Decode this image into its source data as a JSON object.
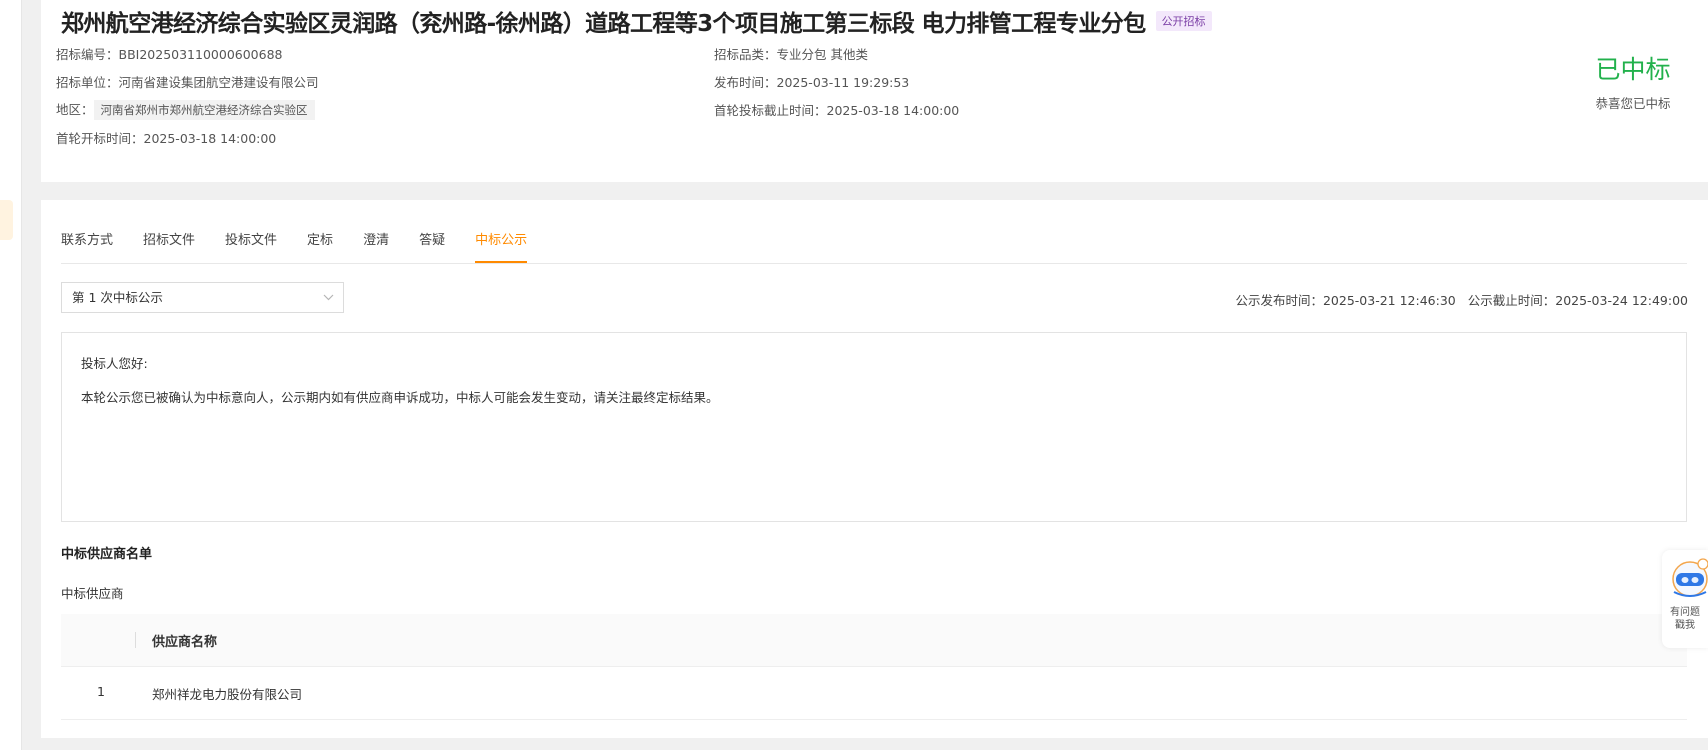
{
  "project": {
    "title": "郑州航空港经济综合实验区灵润路（兖州路-徐州路）道路工程等3个项目施工第三标段 电力排管工程专业分包",
    "badge": "公开招标",
    "bid_no": "招标编号：BBI202503110000600688",
    "category": "招标品类：专业分包 其他类",
    "tenderer": "招标单位：河南省建设集团航空港建设有限公司",
    "publish_time": "发布时间：2025-03-11 19:29:53",
    "region_label": "地区：",
    "region_value": "河南省郑州市郑州航空港经济综合实验区",
    "bid_deadline": "首轮投标截止时间：2025-03-18 14:00:00",
    "open_time": "首轮开标时间：2025-03-18 14:00:00"
  },
  "status": {
    "label": "已中标",
    "sub": "恭喜您已中标",
    "color": "#22b14c"
  },
  "tabs": [
    {
      "label": "联系方式"
    },
    {
      "label": "招标文件"
    },
    {
      "label": "投标文件"
    },
    {
      "label": "定标"
    },
    {
      "label": "澄清"
    },
    {
      "label": "答疑"
    },
    {
      "label": "中标公示"
    }
  ],
  "active_tab": "中标公示",
  "accent_color": "#ff8a00",
  "notice": {
    "round_select": "第 1 次中标公示",
    "publish_time": "公示发布时间：2025-03-21 12:46:30",
    "end_time": "公示截止时间：2025-03-24 12:49:00",
    "greeting": "投标人您好:",
    "body": "本轮公示您已被确认为中标意向人，公示期内如有供应商申诉成功，中标人可能会发生变动，请关注最终定标结果。"
  },
  "winners": {
    "section_title": "中标供应商名单",
    "sub_title": "中标供应商",
    "column_header": "供应商名称",
    "rows": [
      {
        "index": "1",
        "name": "郑州祥龙电力股份有限公司"
      }
    ]
  },
  "help_widget": {
    "line1": "有问题",
    "line2": "戳我",
    "icon": "robot-mascot-icon"
  }
}
